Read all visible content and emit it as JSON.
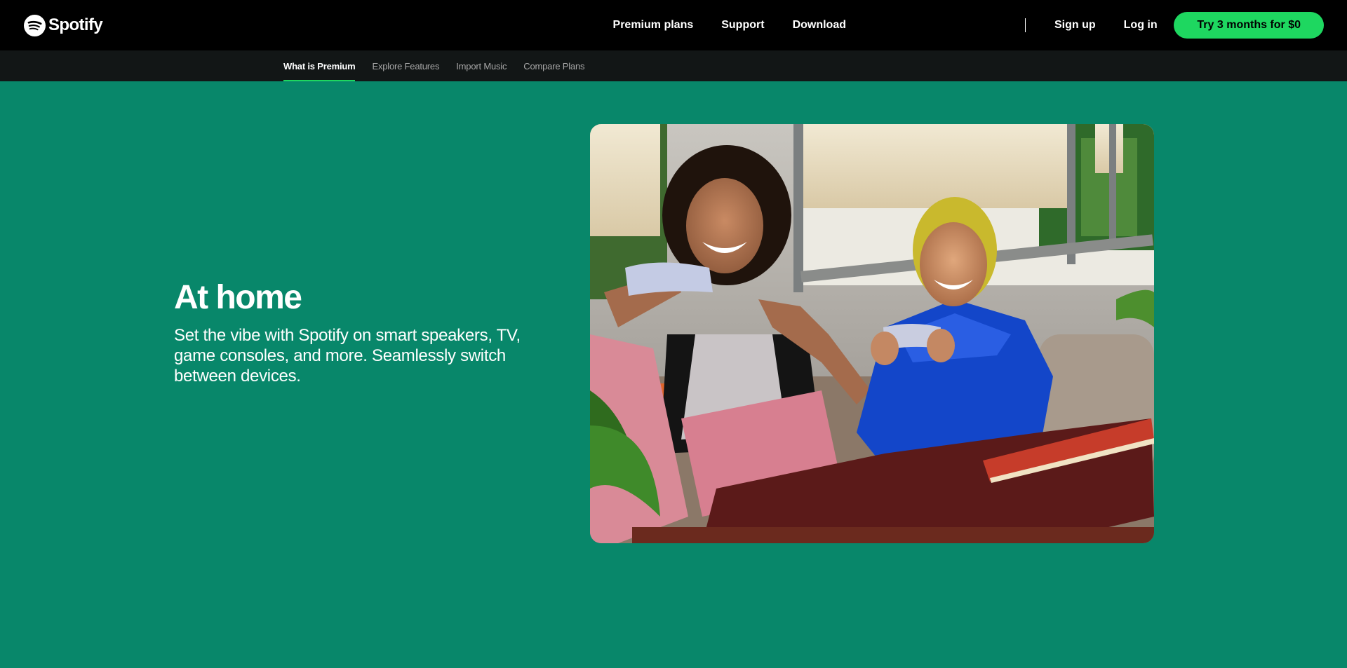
{
  "header": {
    "logo_text": "Spotify",
    "logo_icon": "spotify-logo-icon",
    "nav_main": [
      "Premium plans",
      "Support",
      "Download"
    ],
    "nav_account": [
      "Sign up",
      "Log in"
    ],
    "cta_label": "Try 3 months for $0"
  },
  "subnav": {
    "items": [
      "What is Premium",
      "Explore Features",
      "Import Music",
      "Compare Plans"
    ],
    "active_index": 0
  },
  "hero": {
    "title": "At home",
    "body": "Set the vibe with Spotify on smart speakers, TV, game consoles, and more. Seamlessly switch between devices.",
    "image_alt": "Two friends laughing while playing video games on a couch"
  },
  "colors": {
    "page_bg": "#08876a",
    "header_bg": "#000000",
    "subnav_bg": "#121616",
    "accent": "#1ed760"
  }
}
